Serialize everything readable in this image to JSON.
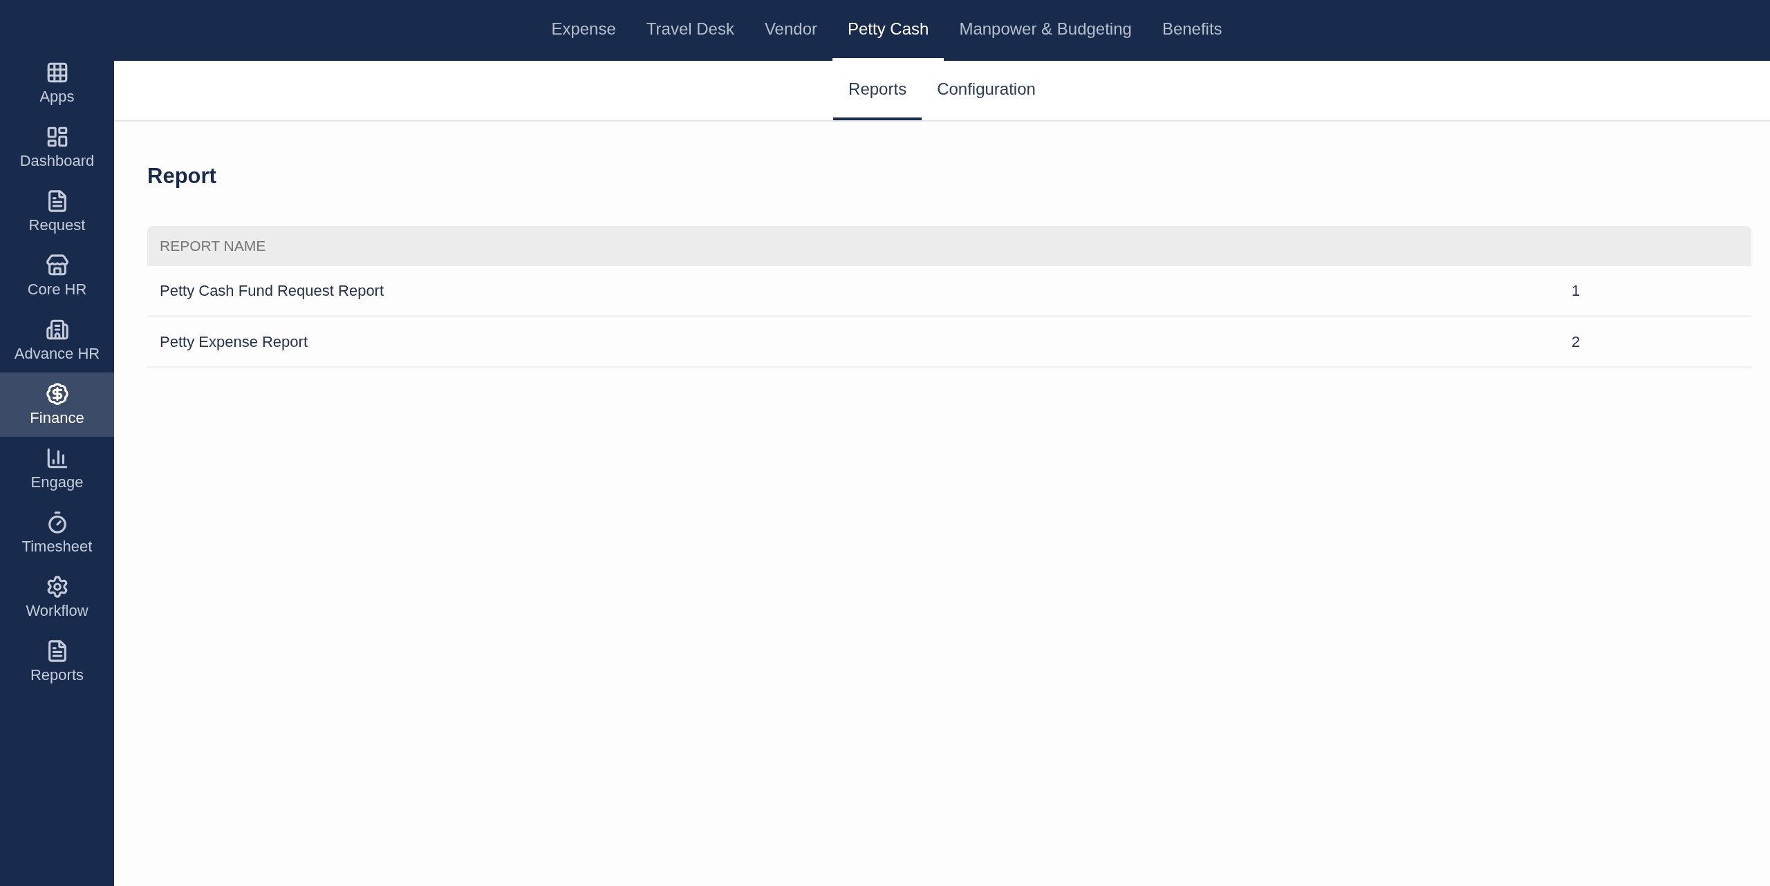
{
  "sidebar": {
    "items": [
      {
        "label": "Apps",
        "selected": false
      },
      {
        "label": "Dashboard",
        "selected": false
      },
      {
        "label": "Request",
        "selected": false
      },
      {
        "label": "Core HR",
        "selected": false
      },
      {
        "label": "Advance HR",
        "selected": false
      },
      {
        "label": "Finance",
        "selected": true
      },
      {
        "label": "Engage",
        "selected": false
      },
      {
        "label": "Timesheet",
        "selected": false
      },
      {
        "label": "Workflow",
        "selected": false
      },
      {
        "label": "Reports",
        "selected": false
      }
    ]
  },
  "top_tabs": [
    {
      "label": "Expense",
      "selected": false
    },
    {
      "label": "Travel Desk",
      "selected": false
    },
    {
      "label": "Vendor",
      "selected": false
    },
    {
      "label": "Petty Cash",
      "selected": true
    },
    {
      "label": "Manpower & Budgeting",
      "selected": false
    },
    {
      "label": "Benefits",
      "selected": false
    }
  ],
  "sub_tabs": [
    {
      "label": "Reports",
      "selected": true
    },
    {
      "label": "Configuration",
      "selected": false
    }
  ],
  "page_title": "Report",
  "table": {
    "columns": [
      "REPORT NAME"
    ],
    "rows": [
      {
        "name": "Petty Cash Fund Request Report",
        "count": "1"
      },
      {
        "name": "Petty Expense Report",
        "count": "2"
      }
    ]
  }
}
